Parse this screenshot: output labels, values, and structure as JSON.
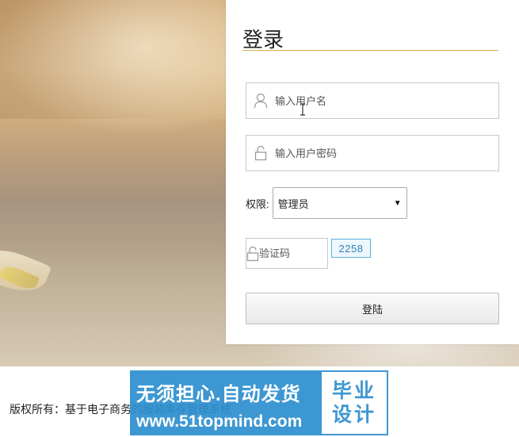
{
  "login": {
    "title": "登录",
    "username_placeholder": "输入用户名",
    "password_placeholder": "输入用户密码",
    "role_label": "权限:",
    "role_selected": "管理员",
    "captcha_placeholder": "验证码",
    "captcha_code": "2258",
    "submit_label": "登陆"
  },
  "footer": {
    "copyright": "版权所有：基于电子商务的服装库存管理系统"
  },
  "watermark": {
    "line1": "无须担心.自动发货",
    "line2": "www.51topmind.com",
    "badge_line1": "毕业",
    "badge_line2": "设计"
  },
  "colors": {
    "title_underline": "#d8a94a",
    "captcha_border": "#5bb0d8",
    "watermark_blue": "#2d8fcf"
  },
  "icons": {
    "username": "user-icon",
    "password": "lock-icon",
    "captcha": "lock-icon",
    "select": "chevron-down-icon"
  }
}
